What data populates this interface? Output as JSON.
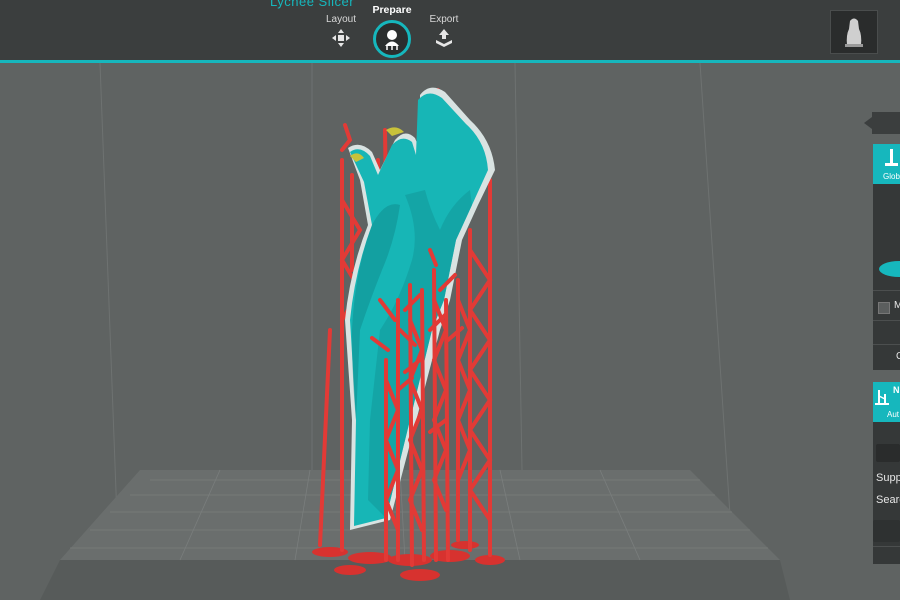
{
  "app": {
    "title_fragment": "Lychee Slicer"
  },
  "toolbar": {
    "tabs": [
      {
        "label": "Layout"
      },
      {
        "label": "Prepare"
      },
      {
        "label": "Export"
      }
    ],
    "active_tab": "Prepare"
  },
  "side_panel": {
    "global": {
      "label": "Glob"
    },
    "checkbox_label": "M",
    "option_label": "C",
    "auto": {
      "badge": "N",
      "label": "Aut"
    },
    "rows": [
      "Supp",
      "Searc"
    ]
  },
  "colors": {
    "accent": "#16b7bd",
    "model": "#17b6b6",
    "supports": "#e23a36",
    "background": "#5f6362",
    "bar": "#3b3e3e"
  },
  "icons": {
    "layout": "move-arrows-icon",
    "prepare": "support-bust-icon",
    "export": "export-tray-icon"
  }
}
